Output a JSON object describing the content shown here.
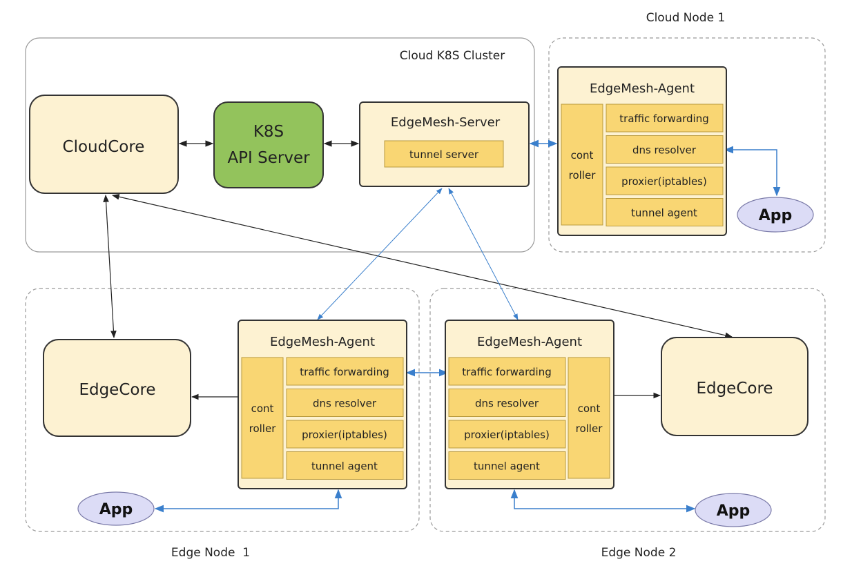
{
  "colors": {
    "cream": "#fdf2d2",
    "yellow": "#f9d673",
    "green": "#93c35c",
    "app": "#dcdcf6",
    "blue": "#3a7fcc",
    "black": "#222222"
  },
  "groups": {
    "cloud_cluster": "Cloud K8S Cluster",
    "cloud_node": "Cloud Node 1",
    "edge_node_1": "Edge Node  1",
    "edge_node_2": "Edge Node 2"
  },
  "cloudcore": "CloudCore",
  "k8s": {
    "line1": "K8S",
    "line2": "API Server"
  },
  "server": {
    "title": "EdgeMesh-Server",
    "tunnel": "tunnel server"
  },
  "agent": {
    "title": "EdgeMesh-Agent",
    "controller_1": "cont",
    "controller_2": "roller",
    "items": [
      "traffic forwarding",
      "dns resolver",
      "proxier(iptables)",
      "tunnel agent"
    ]
  },
  "edgecore": "EdgeCore",
  "app": "App"
}
